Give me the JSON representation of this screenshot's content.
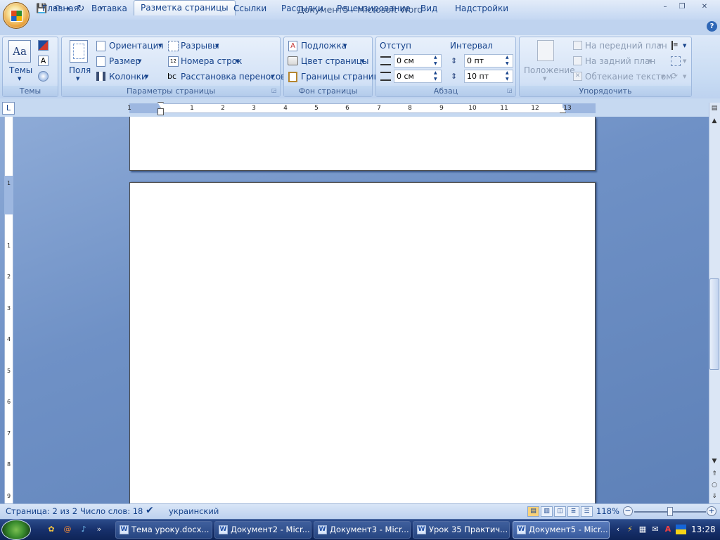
{
  "window": {
    "title": "Документ5 - Microsoft Word",
    "minimize": "–",
    "restore": "❐",
    "close": "✕"
  },
  "quick_access": {
    "save_icon": "💾",
    "undo_icon": "↶",
    "redo_icon": "↻",
    "customize_icon": "▾"
  },
  "tabs": [
    {
      "label": "Главная"
    },
    {
      "label": "Вставка"
    },
    {
      "label": "Разметка страницы",
      "active": true
    },
    {
      "label": "Ссылки"
    },
    {
      "label": "Рассылки"
    },
    {
      "label": "Рецензирование"
    },
    {
      "label": "Вид"
    },
    {
      "label": "Надстройки"
    }
  ],
  "help_icon": "?",
  "ribbon": {
    "themes": {
      "label": "Темы",
      "themes_button": "Темы"
    },
    "page_setup": {
      "label": "Параметры страницы",
      "margins": "Поля",
      "orientation": "Ориентация",
      "size": "Размер",
      "columns": "Колонки",
      "breaks": "Разрывы",
      "line_numbers": "Номера строк",
      "hyphenation": "Расстановка переносов",
      "hyphen_icon": "bc"
    },
    "page_background": {
      "label": "Фон страницы",
      "watermark": "Подложка",
      "page_color": "Цвет страницы",
      "page_borders": "Границы страниц"
    },
    "paragraph": {
      "label": "Абзац",
      "indent_title": "Отступ",
      "spacing_title": "Интервал",
      "indent_left": "0 см",
      "indent_right": "0 см",
      "spacing_before": "0 пт",
      "spacing_after": "10 пт"
    },
    "arrange": {
      "label": "Упорядочить",
      "position": "Положение",
      "bring_front": "На передний план",
      "send_back": "На задний план",
      "text_wrap": "Обтекание текстом"
    }
  },
  "ruler": {
    "tab_selector": "L",
    "h_numbers": [
      "1",
      "1",
      "2",
      "3",
      "4",
      "5",
      "6",
      "7",
      "8",
      "9",
      "10",
      "11",
      "12",
      "13"
    ],
    "v_numbers": [
      "1",
      "1",
      "2",
      "3",
      "4",
      "5",
      "6",
      "7",
      "8",
      "9"
    ]
  },
  "status": {
    "page": "Страница: 2 из 2",
    "words": "Число слов: 18",
    "language": "украинский",
    "zoom": "118%",
    "zoom_minus": "−",
    "zoom_plus": "+"
  },
  "taskbar": {
    "items": [
      {
        "label": "Тема уроку.docx..."
      },
      {
        "label": "Документ2 - Micr..."
      },
      {
        "label": "Документ3 - Micr..."
      },
      {
        "label": "Урок 35 Практич..."
      },
      {
        "label": "Документ5 - Micr...",
        "active": true
      }
    ],
    "clock": "13:28"
  }
}
